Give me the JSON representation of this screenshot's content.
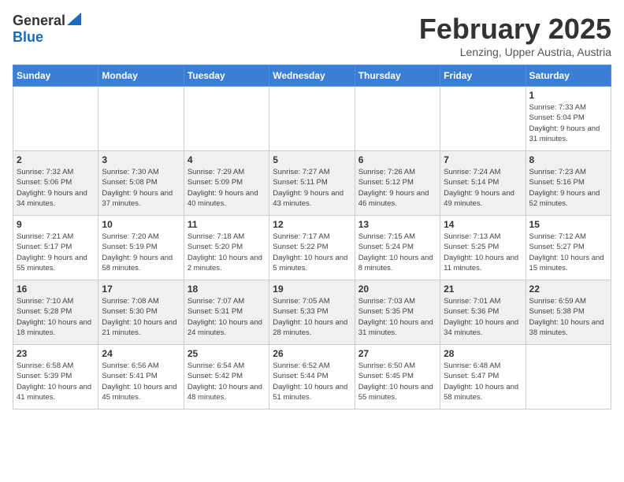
{
  "header": {
    "logo_general": "General",
    "logo_blue": "Blue",
    "month": "February 2025",
    "location": "Lenzing, Upper Austria, Austria"
  },
  "days_of_week": [
    "Sunday",
    "Monday",
    "Tuesday",
    "Wednesday",
    "Thursday",
    "Friday",
    "Saturday"
  ],
  "weeks": [
    [
      {
        "day": "",
        "info": ""
      },
      {
        "day": "",
        "info": ""
      },
      {
        "day": "",
        "info": ""
      },
      {
        "day": "",
        "info": ""
      },
      {
        "day": "",
        "info": ""
      },
      {
        "day": "",
        "info": ""
      },
      {
        "day": "1",
        "info": "Sunrise: 7:33 AM\nSunset: 5:04 PM\nDaylight: 9 hours and 31 minutes."
      }
    ],
    [
      {
        "day": "2",
        "info": "Sunrise: 7:32 AM\nSunset: 5:06 PM\nDaylight: 9 hours and 34 minutes."
      },
      {
        "day": "3",
        "info": "Sunrise: 7:30 AM\nSunset: 5:08 PM\nDaylight: 9 hours and 37 minutes."
      },
      {
        "day": "4",
        "info": "Sunrise: 7:29 AM\nSunset: 5:09 PM\nDaylight: 9 hours and 40 minutes."
      },
      {
        "day": "5",
        "info": "Sunrise: 7:27 AM\nSunset: 5:11 PM\nDaylight: 9 hours and 43 minutes."
      },
      {
        "day": "6",
        "info": "Sunrise: 7:26 AM\nSunset: 5:12 PM\nDaylight: 9 hours and 46 minutes."
      },
      {
        "day": "7",
        "info": "Sunrise: 7:24 AM\nSunset: 5:14 PM\nDaylight: 9 hours and 49 minutes."
      },
      {
        "day": "8",
        "info": "Sunrise: 7:23 AM\nSunset: 5:16 PM\nDaylight: 9 hours and 52 minutes."
      }
    ],
    [
      {
        "day": "9",
        "info": "Sunrise: 7:21 AM\nSunset: 5:17 PM\nDaylight: 9 hours and 55 minutes."
      },
      {
        "day": "10",
        "info": "Sunrise: 7:20 AM\nSunset: 5:19 PM\nDaylight: 9 hours and 58 minutes."
      },
      {
        "day": "11",
        "info": "Sunrise: 7:18 AM\nSunset: 5:20 PM\nDaylight: 10 hours and 2 minutes."
      },
      {
        "day": "12",
        "info": "Sunrise: 7:17 AM\nSunset: 5:22 PM\nDaylight: 10 hours and 5 minutes."
      },
      {
        "day": "13",
        "info": "Sunrise: 7:15 AM\nSunset: 5:24 PM\nDaylight: 10 hours and 8 minutes."
      },
      {
        "day": "14",
        "info": "Sunrise: 7:13 AM\nSunset: 5:25 PM\nDaylight: 10 hours and 11 minutes."
      },
      {
        "day": "15",
        "info": "Sunrise: 7:12 AM\nSunset: 5:27 PM\nDaylight: 10 hours and 15 minutes."
      }
    ],
    [
      {
        "day": "16",
        "info": "Sunrise: 7:10 AM\nSunset: 5:28 PM\nDaylight: 10 hours and 18 minutes."
      },
      {
        "day": "17",
        "info": "Sunrise: 7:08 AM\nSunset: 5:30 PM\nDaylight: 10 hours and 21 minutes."
      },
      {
        "day": "18",
        "info": "Sunrise: 7:07 AM\nSunset: 5:31 PM\nDaylight: 10 hours and 24 minutes."
      },
      {
        "day": "19",
        "info": "Sunrise: 7:05 AM\nSunset: 5:33 PM\nDaylight: 10 hours and 28 minutes."
      },
      {
        "day": "20",
        "info": "Sunrise: 7:03 AM\nSunset: 5:35 PM\nDaylight: 10 hours and 31 minutes."
      },
      {
        "day": "21",
        "info": "Sunrise: 7:01 AM\nSunset: 5:36 PM\nDaylight: 10 hours and 34 minutes."
      },
      {
        "day": "22",
        "info": "Sunrise: 6:59 AM\nSunset: 5:38 PM\nDaylight: 10 hours and 38 minutes."
      }
    ],
    [
      {
        "day": "23",
        "info": "Sunrise: 6:58 AM\nSunset: 5:39 PM\nDaylight: 10 hours and 41 minutes."
      },
      {
        "day": "24",
        "info": "Sunrise: 6:56 AM\nSunset: 5:41 PM\nDaylight: 10 hours and 45 minutes."
      },
      {
        "day": "25",
        "info": "Sunrise: 6:54 AM\nSunset: 5:42 PM\nDaylight: 10 hours and 48 minutes."
      },
      {
        "day": "26",
        "info": "Sunrise: 6:52 AM\nSunset: 5:44 PM\nDaylight: 10 hours and 51 minutes."
      },
      {
        "day": "27",
        "info": "Sunrise: 6:50 AM\nSunset: 5:45 PM\nDaylight: 10 hours and 55 minutes."
      },
      {
        "day": "28",
        "info": "Sunrise: 6:48 AM\nSunset: 5:47 PM\nDaylight: 10 hours and 58 minutes."
      },
      {
        "day": "",
        "info": ""
      }
    ]
  ]
}
